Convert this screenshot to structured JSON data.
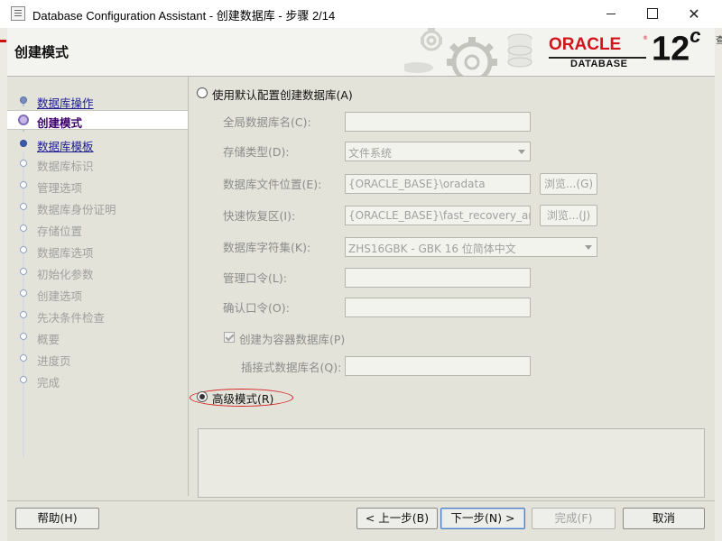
{
  "window": {
    "title": "Database Configuration Assistant - 创建数据库 - 步骤 2/14",
    "close_glyph": "✕"
  },
  "edge_glyph": "查",
  "header": {
    "title": "创建模式",
    "oracle_word": "ORACLE",
    "oracle_reg": "®",
    "database_word": "DATABASE",
    "version": "12",
    "version_sup": "c"
  },
  "nav": {
    "items": [
      {
        "label": "数据库操作",
        "state": "done"
      },
      {
        "label": "创建模式",
        "state": "current"
      },
      {
        "label": "数据库模板",
        "state": "next"
      },
      {
        "label": "数据库标识",
        "state": "disabled"
      },
      {
        "label": "管理选项",
        "state": "disabled"
      },
      {
        "label": "数据库身份证明",
        "state": "disabled"
      },
      {
        "label": "存储位置",
        "state": "disabled"
      },
      {
        "label": "数据库选项",
        "state": "disabled"
      },
      {
        "label": "初始化参数",
        "state": "disabled"
      },
      {
        "label": "创建选项",
        "state": "disabled"
      },
      {
        "label": "先决条件检查",
        "state": "disabled"
      },
      {
        "label": "概要",
        "state": "disabled"
      },
      {
        "label": "进度页",
        "state": "disabled"
      },
      {
        "label": "完成",
        "state": "disabled"
      }
    ]
  },
  "form": {
    "default_config_radio": "使用默认配置创建数据库(A)",
    "global_db_name_label": "全局数据库名(C):",
    "global_db_name_value": "",
    "storage_type_label": "存储类型(D):",
    "storage_type_value": "文件系统",
    "db_file_location_label": "数据库文件位置(E):",
    "db_file_location_value": "{ORACLE_BASE}\\oradata",
    "browse_g": "浏览...(G)",
    "fast_recovery_label": "快速恢复区(I):",
    "fast_recovery_value": "{ORACLE_BASE}\\fast_recovery_area",
    "browse_j": "浏览...(J)",
    "charset_label": "数据库字符集(K):",
    "charset_value": "ZHS16GBK - GBK 16 位简体中文",
    "admin_password_label": "管理口令(L):",
    "confirm_password_label": "确认口令(O):",
    "container_db_label": "创建为容器数据库(P)",
    "container_db_checked": true,
    "pluggable_db_label": "插接式数据库名(Q):",
    "advanced_mode_radio": "高级模式(R)",
    "selected_mode": "advanced"
  },
  "buttons": {
    "help": "帮助(H)",
    "back": "< 上一步(B)",
    "next": "下一步(N) >",
    "finish": "完成(F)",
    "cancel": "取消"
  }
}
